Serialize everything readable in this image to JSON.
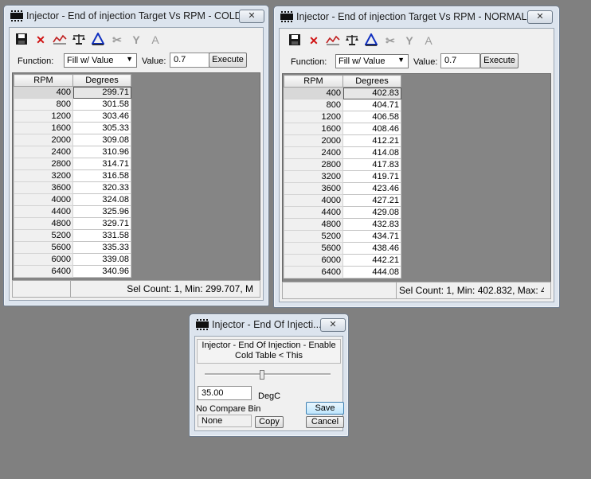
{
  "window_cold": {
    "title": "Injector - End of injection Target Vs RPM - COLD",
    "close": "✕",
    "function_label": "Function:",
    "function_value": "Fill w/ Value",
    "value_label": "Value:",
    "value": "0.7",
    "execute": "Execute",
    "col_rpm": "RPM",
    "col_deg": "Degrees",
    "rows": [
      [
        "400",
        "299.71"
      ],
      [
        "800",
        "301.58"
      ],
      [
        "1200",
        "303.46"
      ],
      [
        "1600",
        "305.33"
      ],
      [
        "2000",
        "309.08"
      ],
      [
        "2400",
        "310.96"
      ],
      [
        "2800",
        "314.71"
      ],
      [
        "3200",
        "316.58"
      ],
      [
        "3600",
        "320.33"
      ],
      [
        "4000",
        "324.08"
      ],
      [
        "4400",
        "325.96"
      ],
      [
        "4800",
        "329.71"
      ],
      [
        "5200",
        "331.58"
      ],
      [
        "5600",
        "335.33"
      ],
      [
        "6000",
        "339.08"
      ],
      [
        "6400",
        "340.96"
      ]
    ],
    "status": "Sel Count: 1, Min: 299.707, M"
  },
  "window_normal": {
    "title": "Injector - End of injection Target Vs RPM - NORMAL",
    "close": "✕",
    "function_label": "Function:",
    "function_value": "Fill w/ Value",
    "value_label": "Value:",
    "value": "0.7",
    "execute": "Execute",
    "col_rpm": "RPM",
    "col_deg": "Degrees",
    "rows": [
      [
        "400",
        "402.83"
      ],
      [
        "800",
        "404.71"
      ],
      [
        "1200",
        "406.58"
      ],
      [
        "1600",
        "408.46"
      ],
      [
        "2000",
        "412.21"
      ],
      [
        "2400",
        "414.08"
      ],
      [
        "2800",
        "417.83"
      ],
      [
        "3200",
        "419.71"
      ],
      [
        "3600",
        "423.46"
      ],
      [
        "4000",
        "427.21"
      ],
      [
        "4400",
        "429.08"
      ],
      [
        "4800",
        "432.83"
      ],
      [
        "5200",
        "434.71"
      ],
      [
        "5600",
        "438.46"
      ],
      [
        "6000",
        "442.21"
      ],
      [
        "6400",
        "444.08"
      ]
    ],
    "status": "Sel Count: 1, Min: 402.832, Max: 4"
  },
  "toolbar_icons": [
    "save-icon",
    "delete-icon",
    "graph-icon",
    "balance-icon",
    "interpolate-icon",
    "cut-icon",
    "split-icon",
    "text-icon"
  ],
  "dialog": {
    "title": "Injector - End Of Injecti...",
    "close": "✕",
    "description": "Injector - End Of Injection - Enable Cold Table < This",
    "slider_level": 0.45,
    "value": "35.00",
    "unit": "DegC",
    "save": "Save",
    "compare_label": "No Compare Bin",
    "compare_value": "None",
    "copy": "Copy",
    "cancel": "Cancel"
  },
  "colors": {
    "desktop": "#808080",
    "window_frame": "#dce4ee",
    "save_icon": "#1a1a1a",
    "delete_icon": "#d01010",
    "graph_icon": "#c02020",
    "interpolate_icon": "#1030c0"
  }
}
